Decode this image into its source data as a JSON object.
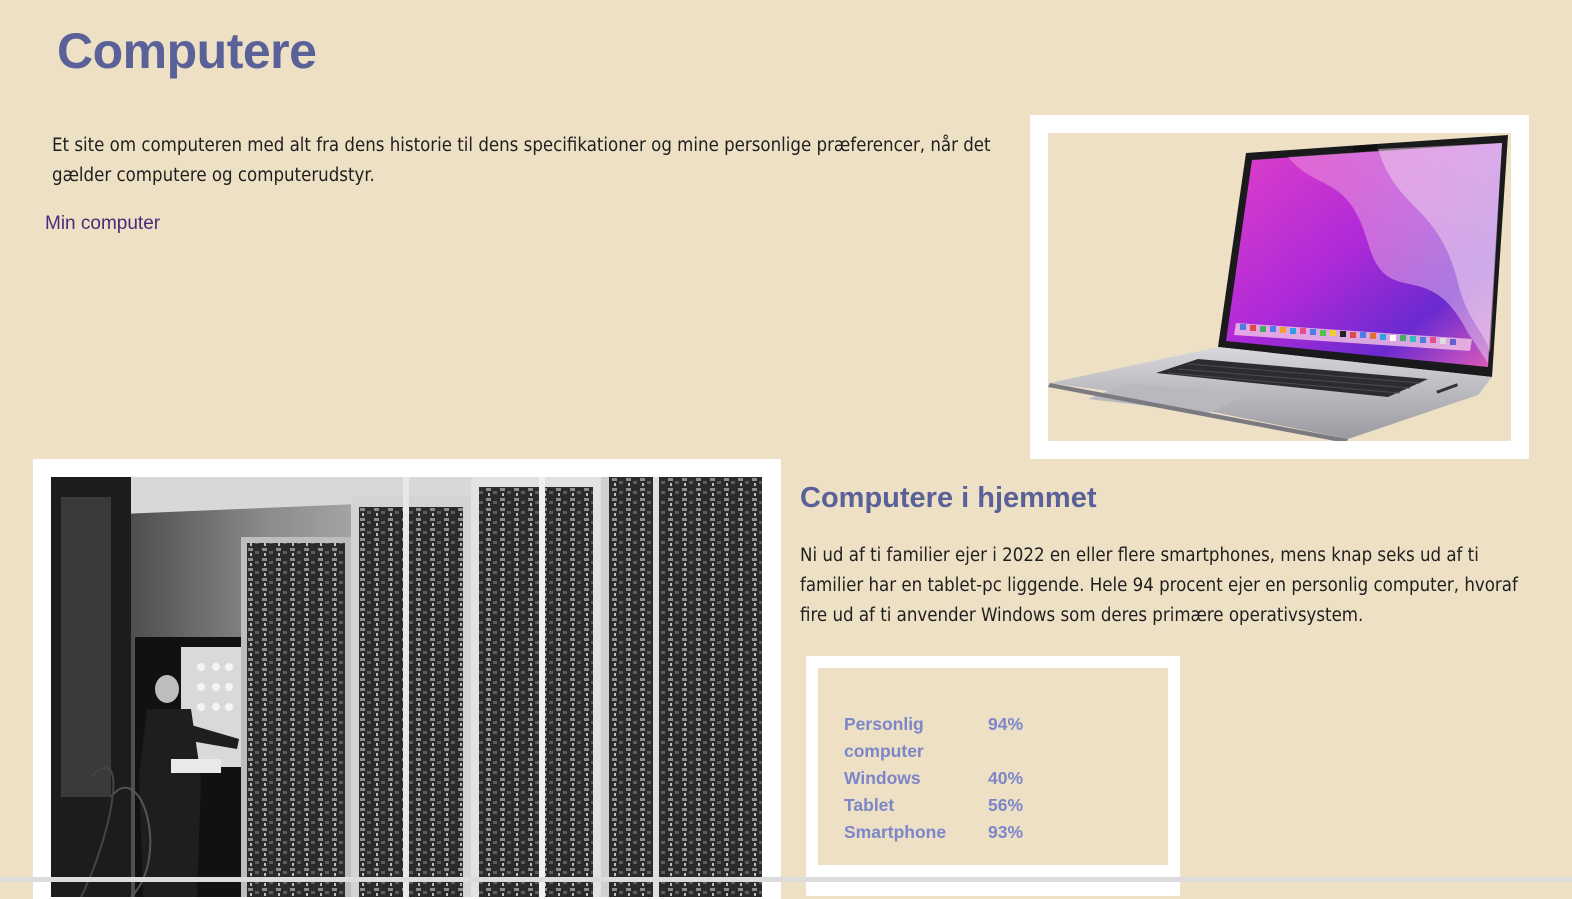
{
  "header": {
    "title": "Computere"
  },
  "intro": {
    "text": "Et site om computeren med alt fra dens historie til dens specifikationer og mine personlige præferencer, når det gælder computere og computerudstyr."
  },
  "nav": {
    "link_label": "Min computer"
  },
  "section": {
    "title": "Computere i hjemmet",
    "text": "Ni ud af ti familier ejer i 2022 en eller flere smartphones, mens knap seks ud af ti familier har en tablet-pc liggende. Hele 94 procent ejer en personlig computer, hvoraf fire ud af ti anvender Windows som deres primære operativsystem."
  },
  "stats": {
    "rows": [
      {
        "label": "Personlig computer",
        "value": "94%"
      },
      {
        "label": "Windows",
        "value": "40%"
      },
      {
        "label": "Tablet",
        "value": "56%"
      },
      {
        "label": "Smartphone",
        "value": "93%"
      }
    ]
  },
  "colors": {
    "background": "#ede0c4",
    "heading": "#5a6199",
    "link": "#4b2a78",
    "stats_text": "#7c86c9"
  }
}
